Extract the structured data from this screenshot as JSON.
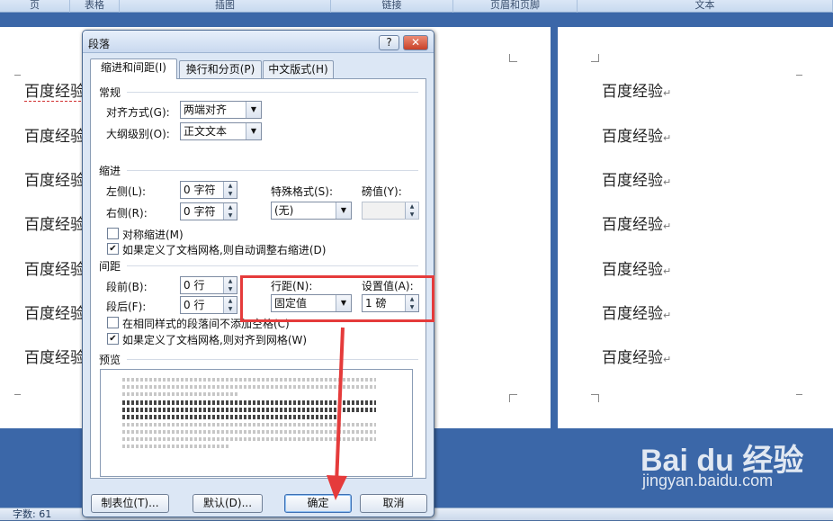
{
  "ribbon": {
    "groups": [
      "页",
      "表格",
      "插图",
      "链接",
      "页眉和页脚",
      "文本"
    ]
  },
  "document": {
    "paragraph_text": "百度经验",
    "left_visible_text": "百度经验",
    "return_mark": "↵"
  },
  "status": {
    "word_count": "字数: 61"
  },
  "watermark": {
    "brand": "Bai du 经验",
    "url": "jingyan.baidu.com"
  },
  "dialog": {
    "title": "段落",
    "help_label": "?",
    "close_label": "✕",
    "tabs": [
      "缩进和间距(I)",
      "换行和分页(P)",
      "中文版式(H)"
    ],
    "general": {
      "heading": "常规",
      "alignment_label": "对齐方式(G):",
      "alignment_value": "两端对齐",
      "outline_label": "大纲级别(O):",
      "outline_value": "正文文本"
    },
    "indent": {
      "heading": "缩进",
      "left_label": "左侧(L):",
      "left_value": "0 字符",
      "right_label": "右侧(R):",
      "right_value": "0 字符",
      "special_label": "特殊格式(S):",
      "special_value": "(无)",
      "by_label": "磅值(Y):",
      "by_value": "",
      "mirror_label": "对称缩进(M)",
      "mirror_checked": false,
      "auto_adjust_label": "如果定义了文档网格,则自动调整右缩进(D)",
      "auto_adjust_checked": true
    },
    "spacing": {
      "heading": "间距",
      "before_label": "段前(B):",
      "before_value": "0 行",
      "after_label": "段后(F):",
      "after_value": "0 行",
      "line_label": "行距(N):",
      "line_value": "固定值",
      "at_label": "设置值(A):",
      "at_value": "1 磅",
      "no_space_label": "在相同样式的段落间不添加空格(C)",
      "no_space_checked": false,
      "snap_label": "如果定义了文档网格,则对齐到网格(W)",
      "snap_checked": true
    },
    "preview": {
      "heading": "预览"
    },
    "buttons": {
      "tabs_label": "制表位(T)...",
      "default_label": "默认(D)...",
      "ok_label": "确定",
      "cancel_label": "取消"
    }
  },
  "annotation": {
    "color": "#e53b3b"
  }
}
